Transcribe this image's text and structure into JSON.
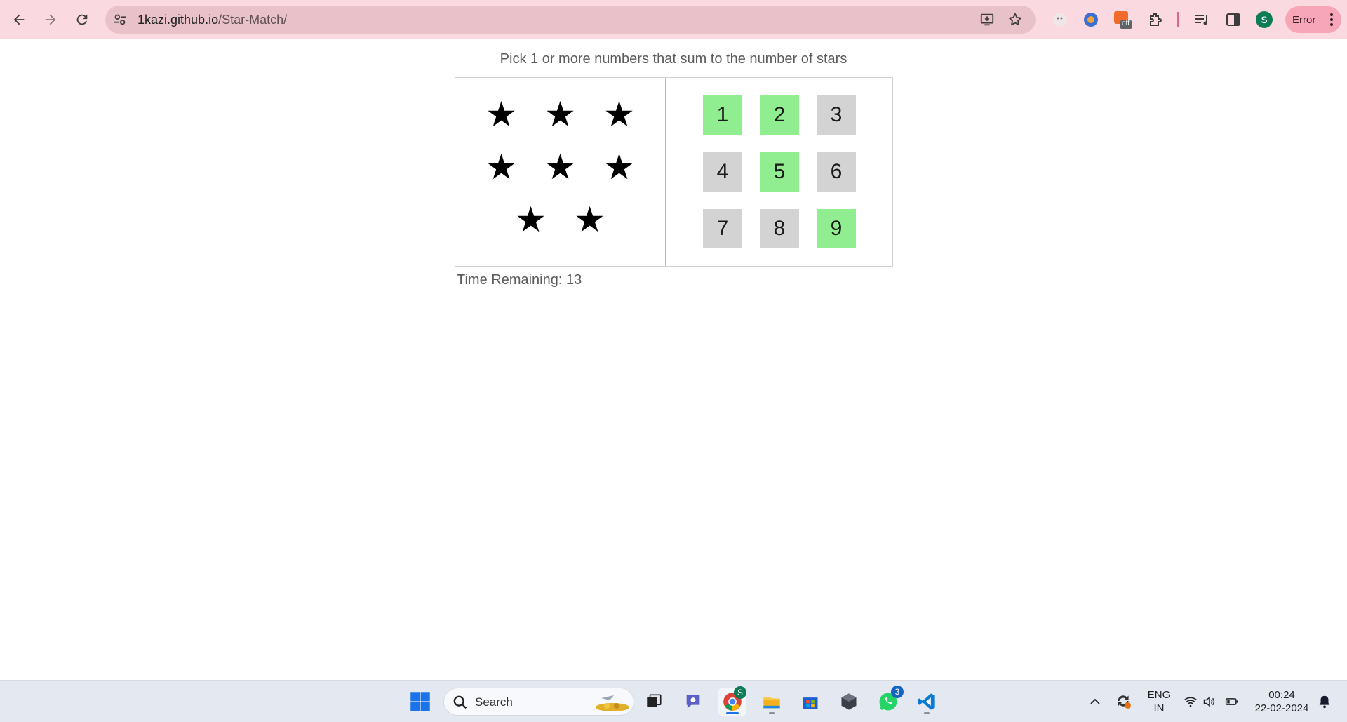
{
  "browser": {
    "url_host": "1kazi.github.io",
    "url_path": "/Star-Match/",
    "profile_initial": "S",
    "error_label": "Error",
    "ext_badge": "off"
  },
  "game": {
    "help_text": "Pick 1 or more numbers that sum to the number of stars",
    "stars": [
      "★",
      "★",
      "★",
      "★",
      "★",
      "★",
      "★",
      "★"
    ],
    "numbers": [
      {
        "label": "1",
        "status": "available"
      },
      {
        "label": "2",
        "status": "available"
      },
      {
        "label": "3",
        "status": "used"
      },
      {
        "label": "4",
        "status": "used"
      },
      {
        "label": "5",
        "status": "available"
      },
      {
        "label": "6",
        "status": "used"
      },
      {
        "label": "7",
        "status": "used"
      },
      {
        "label": "8",
        "status": "used"
      },
      {
        "label": "9",
        "status": "available"
      }
    ],
    "status_colors": {
      "available": "#90ee90",
      "used": "#d3d3d3"
    },
    "timer_text": "Time Remaining: 13"
  },
  "taskbar": {
    "search_label": "Search",
    "whatsapp_badge": "3",
    "chrome_badge": "S",
    "lang_line1": "ENG",
    "lang_line2": "IN",
    "time": "00:24",
    "date": "22-02-2024"
  }
}
